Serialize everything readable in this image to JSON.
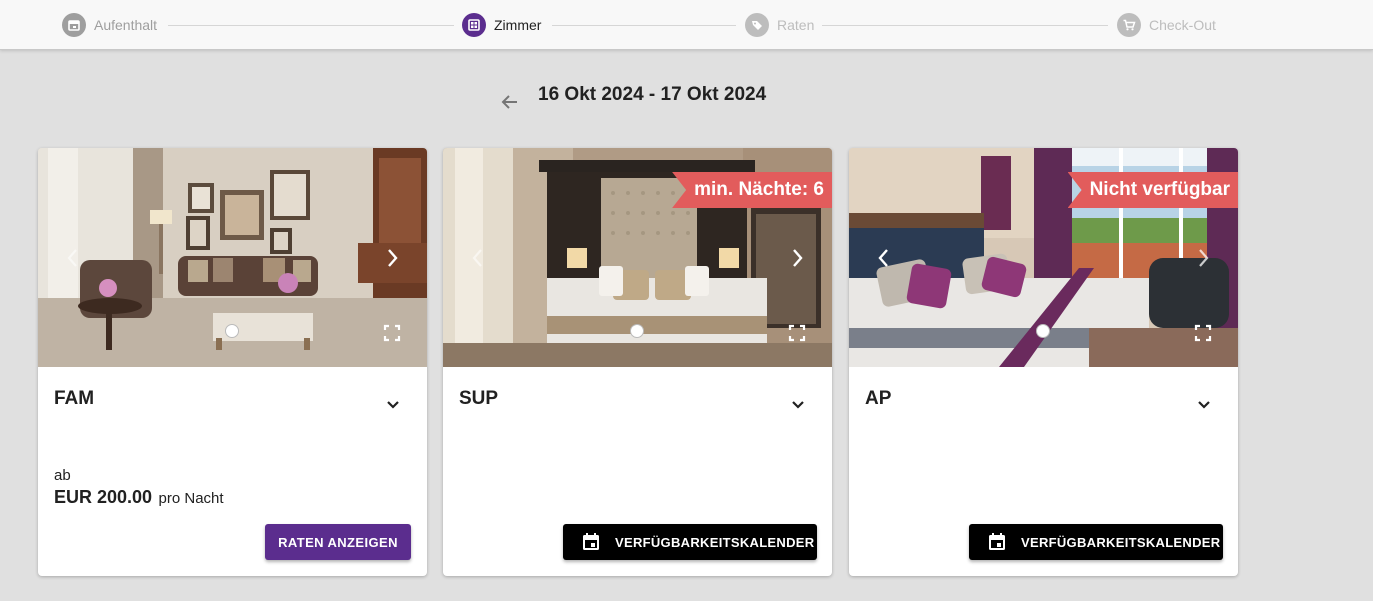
{
  "stepper": {
    "steps": [
      {
        "label": "Aufenthalt",
        "icon": "calendar-icon",
        "state": "done"
      },
      {
        "label": "Zimmer",
        "icon": "room-grid-icon",
        "state": "active"
      },
      {
        "label": "Raten",
        "icon": "tag-icon",
        "state": "disabled"
      },
      {
        "label": "Check-Out",
        "icon": "cart-icon",
        "state": "disabled"
      }
    ]
  },
  "header": {
    "back_icon": "arrow-back-icon",
    "date_range": "16 Okt 2024 - 17 Okt 2024"
  },
  "rooms": [
    {
      "name": "FAM",
      "ribbon": "",
      "price_from": "ab",
      "price_amount": "EUR 200.00",
      "price_unit": "pro Nacht",
      "action_label": "RATEN ANZEIGEN",
      "action_type": "rates"
    },
    {
      "name": "SUP",
      "ribbon": "min. Nächte: 6",
      "action_label": "VERFÜGBARKEITSKALENDER",
      "action_type": "calendar"
    },
    {
      "name": "AP",
      "ribbon": "Nicht verfügbar",
      "action_label": "VERFÜGBARKEITSKALENDER",
      "action_type": "calendar"
    }
  ],
  "colors": {
    "accent": "#5b2d8e",
    "ribbon": "#e25c5c",
    "background": "#e0e0e0",
    "calendar_button": "#000000"
  }
}
